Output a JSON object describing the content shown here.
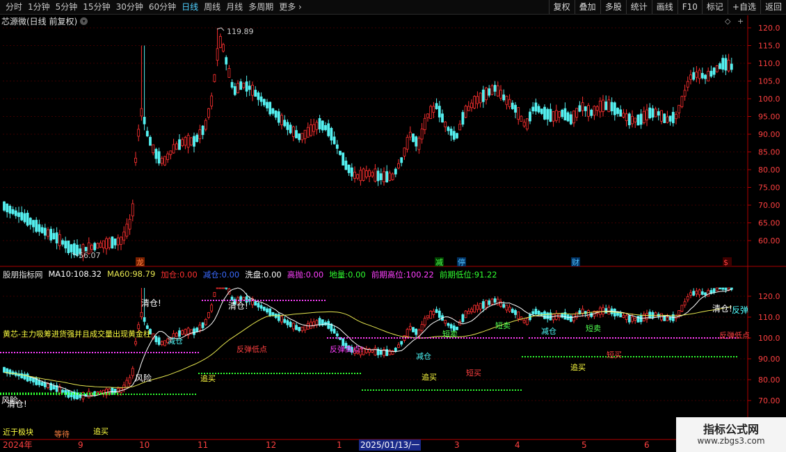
{
  "toolbar": {
    "timeframes": [
      "分时",
      "1分钟",
      "5分钟",
      "15分钟",
      "30分钟",
      "60分钟",
      "日线",
      "周线",
      "月线",
      "多周期"
    ],
    "active": "日线",
    "more_label": "更多",
    "right_buttons": [
      "复权",
      "叠加",
      "多股",
      "统计",
      "画线",
      "F10",
      "标记",
      "+自选",
      "返回"
    ]
  },
  "chart_title": "芯源微(日线 前复权)",
  "price_axis": [
    "120.0",
    "115.0",
    "110.0",
    "105.0",
    "100.0",
    "95.00",
    "90.00",
    "85.00",
    "80.00",
    "75.00",
    "70.00",
    "65.00",
    "60.00"
  ],
  "price_high_label": "119.89",
  "price_low_label": "56.07",
  "event_markers": {
    "m1": "龙",
    "m2": "减",
    "m3": "停",
    "m4": "财",
    "m5": "$"
  },
  "indicator": {
    "name": "股朋指标网",
    "ma10_label": "MA10:",
    "ma10_value": "108.32",
    "ma60_label": "MA60:",
    "ma60_value": "98.79",
    "add_label": "加仓:",
    "add_value": "0.00",
    "reduce_label": "减仓:",
    "reduce_value": "0.00",
    "wash_label": "洗盘:",
    "wash_value": "0.00",
    "high_label": "高抛:",
    "high_value": "0.00",
    "low_label": "地量:",
    "low_value": "0.00",
    "prev_high_label": "前期高位:",
    "prev_high_value": "100.22",
    "prev_low_label": "前期低位:",
    "prev_low_value": "91.22"
  },
  "indicator_axis": [
    "120.0",
    "110.0",
    "100.0",
    "90.00",
    "80.00",
    "70.00"
  ],
  "annotations": {
    "golden": "黄芯-主力吸筹进货强并且成交量出现黄金柱",
    "qingcang": "清仓!",
    "fengxian": "风险",
    "jiancang": "减仓",
    "fandan_low": "反弹低点",
    "fandan_high": "反弹高点!",
    "duanmai": "短卖",
    "duanmai2": "短买",
    "zhuimai": "追买",
    "fandan": "反弹",
    "fandan_di": "反弹低点",
    "dinghuo": "近于极块",
    "wait": "等待"
  },
  "dates": [
    "2024年",
    "9",
    "10",
    "11",
    "12",
    "1",
    "3",
    "4",
    "5",
    "6"
  ],
  "selected_date": "2025/01/13/一",
  "watermark": {
    "title": "指标公式网",
    "url": "www.zbgs3.com"
  },
  "colors": {
    "up": "#ff3030",
    "down": "#54f0f0",
    "ma10": "#ffffff",
    "ma60": "#e8e850",
    "axis": "#ff4040",
    "grid": "#8b0000"
  }
}
